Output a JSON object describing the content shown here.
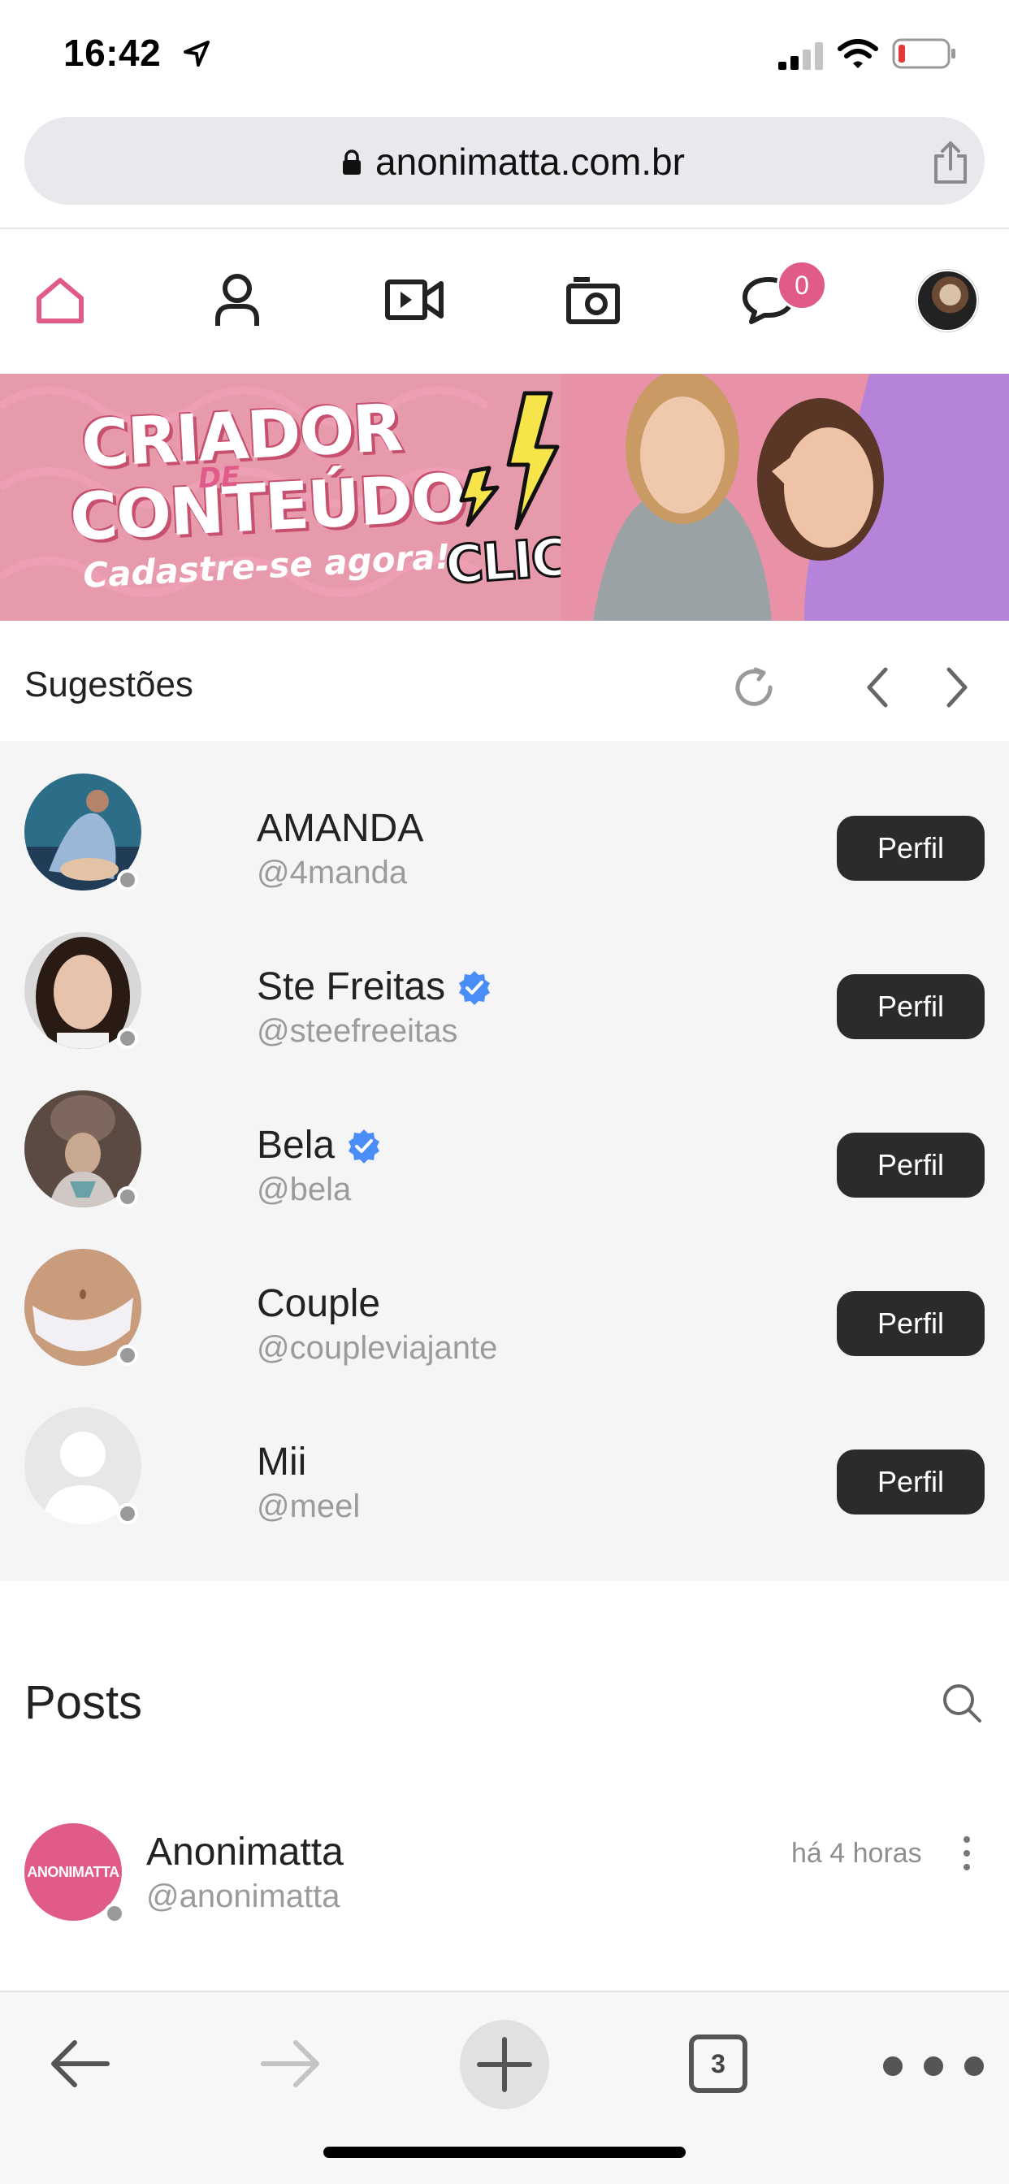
{
  "status_bar": {
    "time": "16:42"
  },
  "browser": {
    "url": "anonimatta.com.br",
    "tab_count": "3"
  },
  "nav": {
    "messages_badge": "0"
  },
  "banner": {
    "line1": "CRIADOR",
    "connector": "DE",
    "line2": "CONTEÚDO",
    "subtitle": "Cadastre-se agora!",
    "cta": "CLICOU?"
  },
  "suggestions": {
    "title": "Sugestões",
    "button_label": "Perfil",
    "items": [
      {
        "name": "AMANDA",
        "handle": "@4manda",
        "verified": false
      },
      {
        "name": "Ste Freitas",
        "handle": "@steefreeitas",
        "verified": true
      },
      {
        "name": "Bela",
        "handle": "@bela",
        "verified": true
      },
      {
        "name": "Couple",
        "handle": "@coupleviajante",
        "verified": false
      },
      {
        "name": "Mii",
        "handle": "@meel",
        "verified": false
      }
    ]
  },
  "posts": {
    "title": "Posts",
    "items": [
      {
        "avatar_text": "ANONIMATTA",
        "name": "Anonimatta",
        "handle": "@anonimatta",
        "time": "há 4 horas"
      }
    ]
  },
  "colors": {
    "accent": "#e05a8a",
    "button_dark": "#2a2b2d",
    "verified": "#4a8df6"
  }
}
